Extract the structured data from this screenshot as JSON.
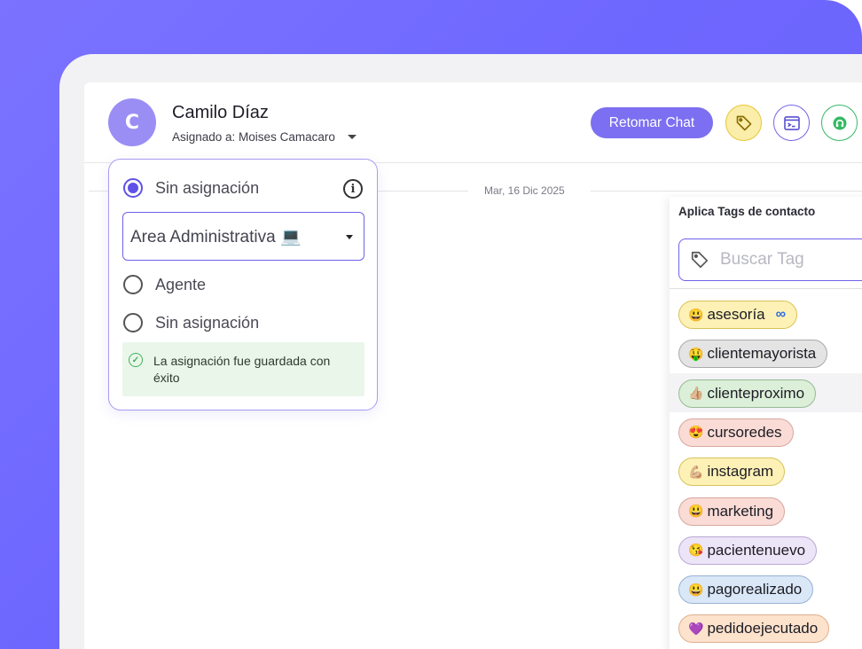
{
  "contact": {
    "initial": "C",
    "name": "Camilo Díaz",
    "assigned_text": "Asignado a: Moises Camacaro"
  },
  "header": {
    "retake_label": "Retomar Chat",
    "icons": [
      "tag-icon",
      "terminal-icon",
      "support-icon"
    ],
    "colors": {
      "accent": "#7c6ff1",
      "tag_button": "#fbeeaa",
      "support": "#35b964"
    }
  },
  "chat": {
    "date": "Mar, 16 Dic 2025"
  },
  "assign_popup": {
    "option_selected": "Sin asignación",
    "area_select_value": "Area Administrativa 💻",
    "option_agent": "Agente",
    "option_none": "Sin asignación",
    "success_message": "La asignación fue guardada con éxito"
  },
  "tags_panel": {
    "title": "Aplica Tags de contacto",
    "search_placeholder": "Buscar Tag",
    "tags": [
      {
        "emoji": "😃",
        "label": "asesoría",
        "extra": "∞",
        "color": "#fdf1b6",
        "border": "#d9c25a"
      },
      {
        "emoji": "🤑",
        "label": "clientemayorista",
        "extra": "",
        "color": "#e4e4e4",
        "border": "#a9a9a9"
      },
      {
        "emoji": "👍🏼",
        "label": "clienteproximo",
        "extra": "",
        "color": "#dcefd9",
        "border": "#98b994"
      },
      {
        "emoji": "😍",
        "label": "cursoredes",
        "extra": "",
        "color": "#fadbd6",
        "border": "#d7a79f"
      },
      {
        "emoji": "💪🏼",
        "label": "instagram",
        "extra": "",
        "color": "#fdf1b6",
        "border": "#d9c25a"
      },
      {
        "emoji": "😃",
        "label": "marketing",
        "extra": "",
        "color": "#fadbd6",
        "border": "#d7a79f"
      },
      {
        "emoji": "😘",
        "label": "pacientenuevo",
        "extra": "",
        "color": "#ece4f7",
        "border": "#b9a9d3"
      },
      {
        "emoji": "😃",
        "label": "pagorealizado",
        "extra": "",
        "color": "#d9e7f7",
        "border": "#97b2d3"
      },
      {
        "emoji": "💜",
        "label": "pedidoejecutado",
        "extra": "",
        "color": "#fde2cc",
        "border": "#dfb08f"
      }
    ]
  }
}
